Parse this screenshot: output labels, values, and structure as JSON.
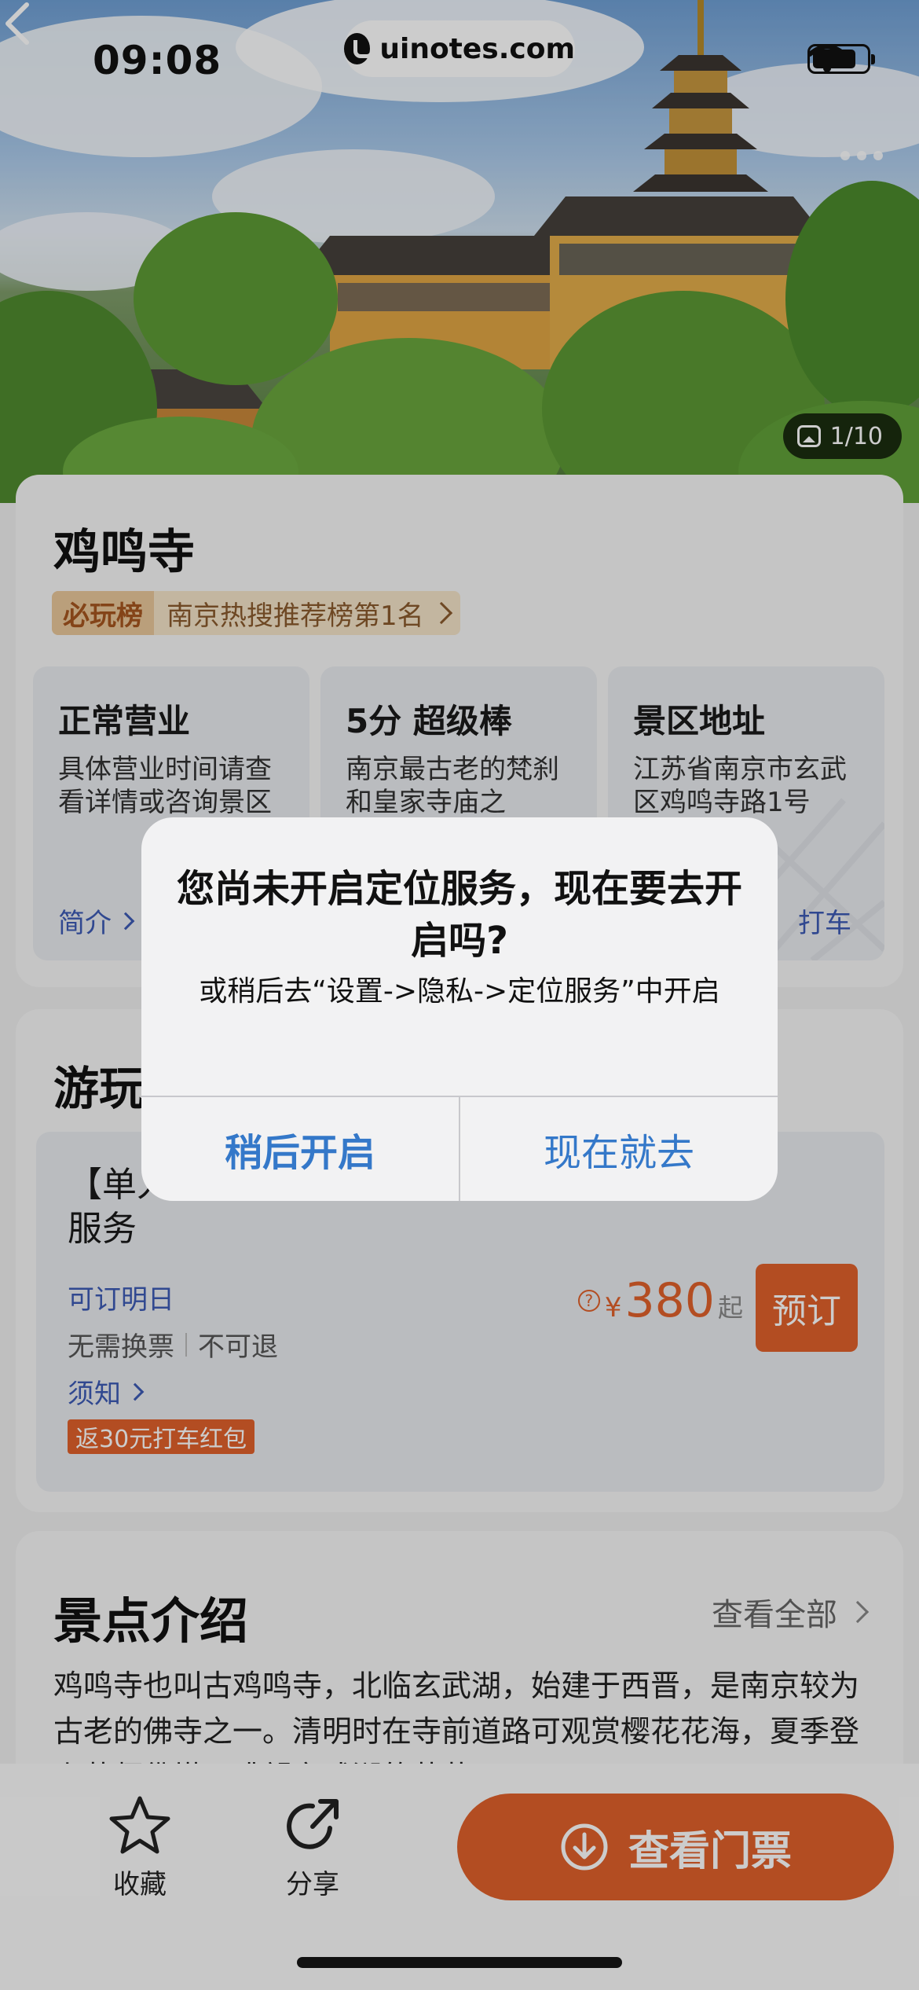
{
  "status_bar": {
    "time": "09:08",
    "url": "uinotes.com"
  },
  "hero": {
    "photo_counter": "1/10"
  },
  "attraction": {
    "name": "鸡鸣寺",
    "rank_tag": "必玩榜",
    "rank_text": "南京热搜推荐榜第1名"
  },
  "tiles": [
    {
      "title": "正常营业",
      "desc": "具体营业时间请查看详情或咨询景区",
      "link": "简介"
    },
    {
      "title": "5分 超级棒",
      "desc": "南京最古老的梵刹和皇家寺庙之"
    },
    {
      "title": "景区地址",
      "desc": "江苏省南京市玄武区鸡鸣寺路1号",
      "link": "打车"
    }
  ],
  "tickets": {
    "heading": "游玩",
    "item_name": "【单人】鸡鸣寺 VIP 人工讲解服务",
    "date_note": "可订明日",
    "tag1": "无需换票",
    "tag2": "不可退",
    "notice": "须知",
    "coupon": "返30元打车红包",
    "price_currency": "¥",
    "price_value": "380",
    "price_suffix": "起",
    "book_label": "预订"
  },
  "intro": {
    "heading": "景点介绍",
    "view_all": "查看全部",
    "text": "鸡鸣寺也叫古鸡鸣寺，北临玄武湖，始建于西晋，是南京较为古老的佛寺之一。清明时在寺前道路可观赏樱花花海，夏季登上药师佛塔可眺望玄武湖的荷花"
  },
  "bottom_bar": {
    "favorite_label": "收藏",
    "share_label": "分享",
    "tickets_label": "查看门票"
  },
  "dialog": {
    "title": "您尚未开启定位服务，现在要去开启吗?",
    "message": "或稍后去“设置->隐私->定位服务”中开启",
    "later_button": "稍后开启",
    "go_button": "现在就去"
  },
  "colors": {
    "accent": "#e0612b",
    "link": "#3c5ab4",
    "dialog_button": "#3478c9"
  }
}
